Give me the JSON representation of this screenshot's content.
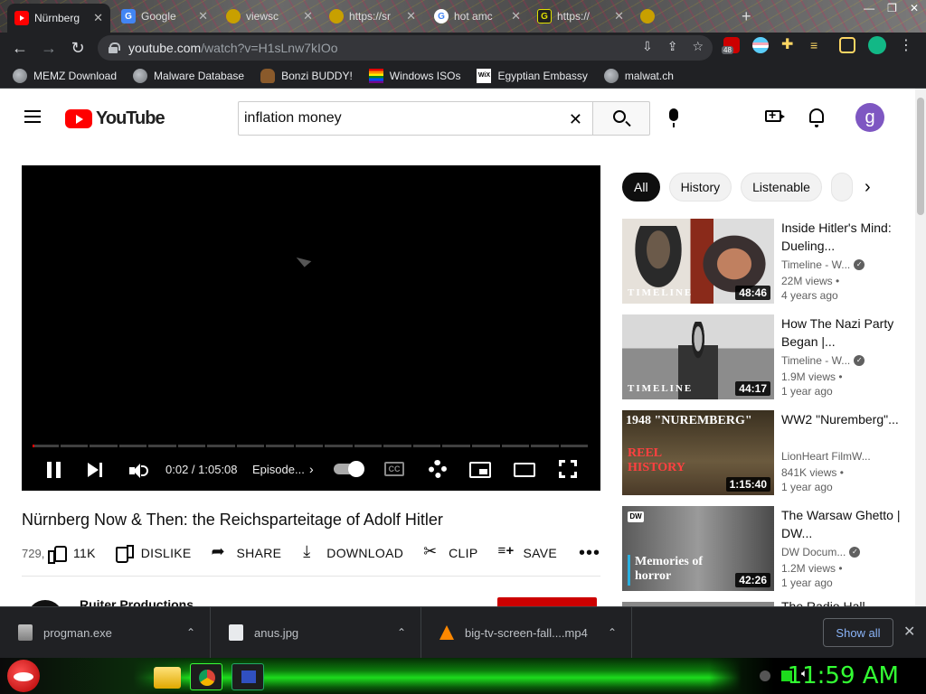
{
  "browser": {
    "tabs": [
      {
        "title": "Nürnberg",
        "active": true
      },
      {
        "title": "Google"
      },
      {
        "title": "viewsc"
      },
      {
        "title": "https://sr"
      },
      {
        "title": "hot amc"
      },
      {
        "title": "https://"
      }
    ],
    "url_host": "youtube.com",
    "url_path": "/watch?v=H1sLnw7kIOo",
    "ext_badge": "48",
    "bookmarks": [
      "MEMZ Download",
      "Malware Database",
      "Bonzi BUDDY!",
      "Windows ISOs",
      "Egyptian Embassy",
      "malwat.ch"
    ]
  },
  "youtube": {
    "logo_text": "YouTube",
    "search_value": "inflation money",
    "user_initial": "g",
    "player": {
      "time": "0:02 / 1:05:08",
      "chapter": "Episode...",
      "cc_label": "CC",
      "progress_fraction": 0.0005
    },
    "video": {
      "title": "Nürnberg Now & Then: the Reichsparteitage of Adolf Hitler",
      "views": "729,",
      "likes": "11K",
      "dislike": "DISLIKE",
      "share": "SHARE",
      "download": "DOWNLOAD",
      "clip": "CLIP",
      "save": "SAVE",
      "channel_peek": "Ruiter Productions"
    },
    "chips": [
      "All",
      "History",
      "Listenable"
    ],
    "recommendations": [
      {
        "title": "Inside Hitler's Mind: Dueling...",
        "channel": "Timeline - W...",
        "views": "22M views •",
        "age": "4 years ago",
        "duration": "48:46",
        "thumb_label": "TIMELINE"
      },
      {
        "title": "How The Nazi Party Began |...",
        "channel": "Timeline - W...",
        "views": "1.9M views •",
        "age": "1 year ago",
        "duration": "44:17",
        "thumb_label": "TIMELINE"
      },
      {
        "title": "WW2 \"Nuremberg\"...",
        "channel": "LionHeart FilmW...",
        "views": "841K views •",
        "age": "1 year ago",
        "duration": "1:15:40",
        "thumb_label": "1948 \"NUREMBERG\"",
        "thumb_label2": "REEL HISTORY"
      },
      {
        "title": "The Warsaw Ghetto | DW...",
        "channel": "DW Docum...",
        "views": "1.2M views •",
        "age": "1 year ago",
        "duration": "42:26",
        "thumb_label": "Memories of horror"
      }
    ],
    "next_peek": "The Radio Hall"
  },
  "downloads": {
    "items": [
      "progman.exe",
      "anus.jpg",
      "big-tv-screen-fall....mp4"
    ],
    "show_all": "Show all"
  },
  "taskbar": {
    "clock": "11:59 AM"
  }
}
